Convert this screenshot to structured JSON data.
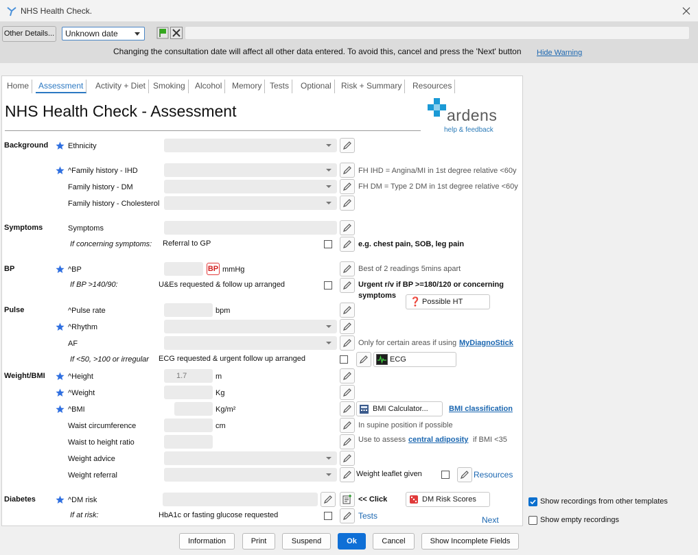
{
  "window": {
    "title": "NHS Health Check."
  },
  "topbar": {
    "other_details": "Other Details...",
    "date_value": "Unknown date",
    "warning": "Changing the consultation date will affect all other data entered. To avoid this, cancel and press the 'Next' button",
    "hide_warning": "Hide Warning"
  },
  "tabs": [
    "Home",
    "Assessment",
    "Activity + Diet",
    "Smoking",
    "Alcohol",
    "Memory",
    "Tests",
    "Optional",
    "Risk + Summary",
    "Resources"
  ],
  "page": {
    "title": "NHS Health Check - Assessment",
    "logo": "ardens",
    "logo_sub": "help & feedback"
  },
  "sections": {
    "background": "Background",
    "symptoms": "Symptoms",
    "bp": "BP",
    "pulse": "Pulse",
    "weight_bmi": "Weight/BMI",
    "diabetes": "Diabetes"
  },
  "labels": {
    "ethnicity": "Ethnicity",
    "fh_ihd": "^Family history - IHD",
    "fh_dm": "Family history - DM",
    "fh_chol": "Family history - Cholesterol",
    "symptoms": "Symptoms",
    "if_concerning": "If concerning symptoms:",
    "referral_gp": "Referral to GP",
    "bp": "^BP",
    "if_bp": "If BP >140/90:",
    "ues": "U&Es requested & follow up arranged",
    "pulse_rate": "^Pulse rate",
    "rhythm": "^Rhythm",
    "af": "AF",
    "if_irregular": "If <50, >100 or irregular",
    "ecg_requested": "ECG requested & urgent follow up arranged",
    "height": "^Height",
    "weight": "^Weight",
    "bmi": "^BMI",
    "waist": "Waist circumference",
    "waist_height": "Waist to height ratio",
    "weight_advice": "Weight advice",
    "weight_referral": "Weight referral",
    "dm_risk": "^DM risk",
    "if_at_risk": "If at risk:",
    "hba1c": "HbA1c or fasting glucose requested"
  },
  "units": {
    "mmhg": "mmHg",
    "bpm": "bpm",
    "m": "m",
    "kg": "Kg",
    "kgm2": "Kg/m²",
    "cm": "cm"
  },
  "values": {
    "height": "1.7"
  },
  "hints": {
    "fh_ihd": "FH IHD = Angina/MI in 1st degree relative <60y",
    "fh_dm": "FH DM = Type 2 DM in 1st degree relative <60y",
    "symptoms_eg": "e.g. chest pain, SOB, leg pain",
    "bp_best": "Best of 2 readings 5mins apart",
    "bp_urgent_1": "Urgent r/v if BP >=180/120 or concerning",
    "bp_urgent_2": "symptoms",
    "af_only": "Only for certain areas if using",
    "af_link": "MyDiagnoStick",
    "waist": "In supine position if possible",
    "waist_height_pre": "Use to assess",
    "waist_height_link": "central adiposity",
    "waist_height_post": "if BMI <35",
    "weight_leaflet": "Weight leaflet given",
    "dm_click": "<< Click"
  },
  "buttons": {
    "bp_icon": "BP",
    "possible_ht": "Possible HT",
    "ecg": "ECG",
    "bmi_calc": "BMI Calculator...",
    "bmi_class": "BMI classification",
    "resources": "Resources",
    "dm_risk_scores": "DM Risk Scores",
    "tests": "Tests",
    "next": "Next"
  },
  "options": {
    "show_other": "Show recordings from other templates",
    "show_empty": "Show empty recordings"
  },
  "footer": {
    "information": "Information",
    "print": "Print",
    "suspend": "Suspend",
    "ok": "Ok",
    "cancel": "Cancel",
    "show_incomplete": "Show Incomplete Fields"
  },
  "colors": {
    "accent": "#2b78c2",
    "primary_button": "#0f6fd6",
    "star": "#2f6fe0"
  }
}
